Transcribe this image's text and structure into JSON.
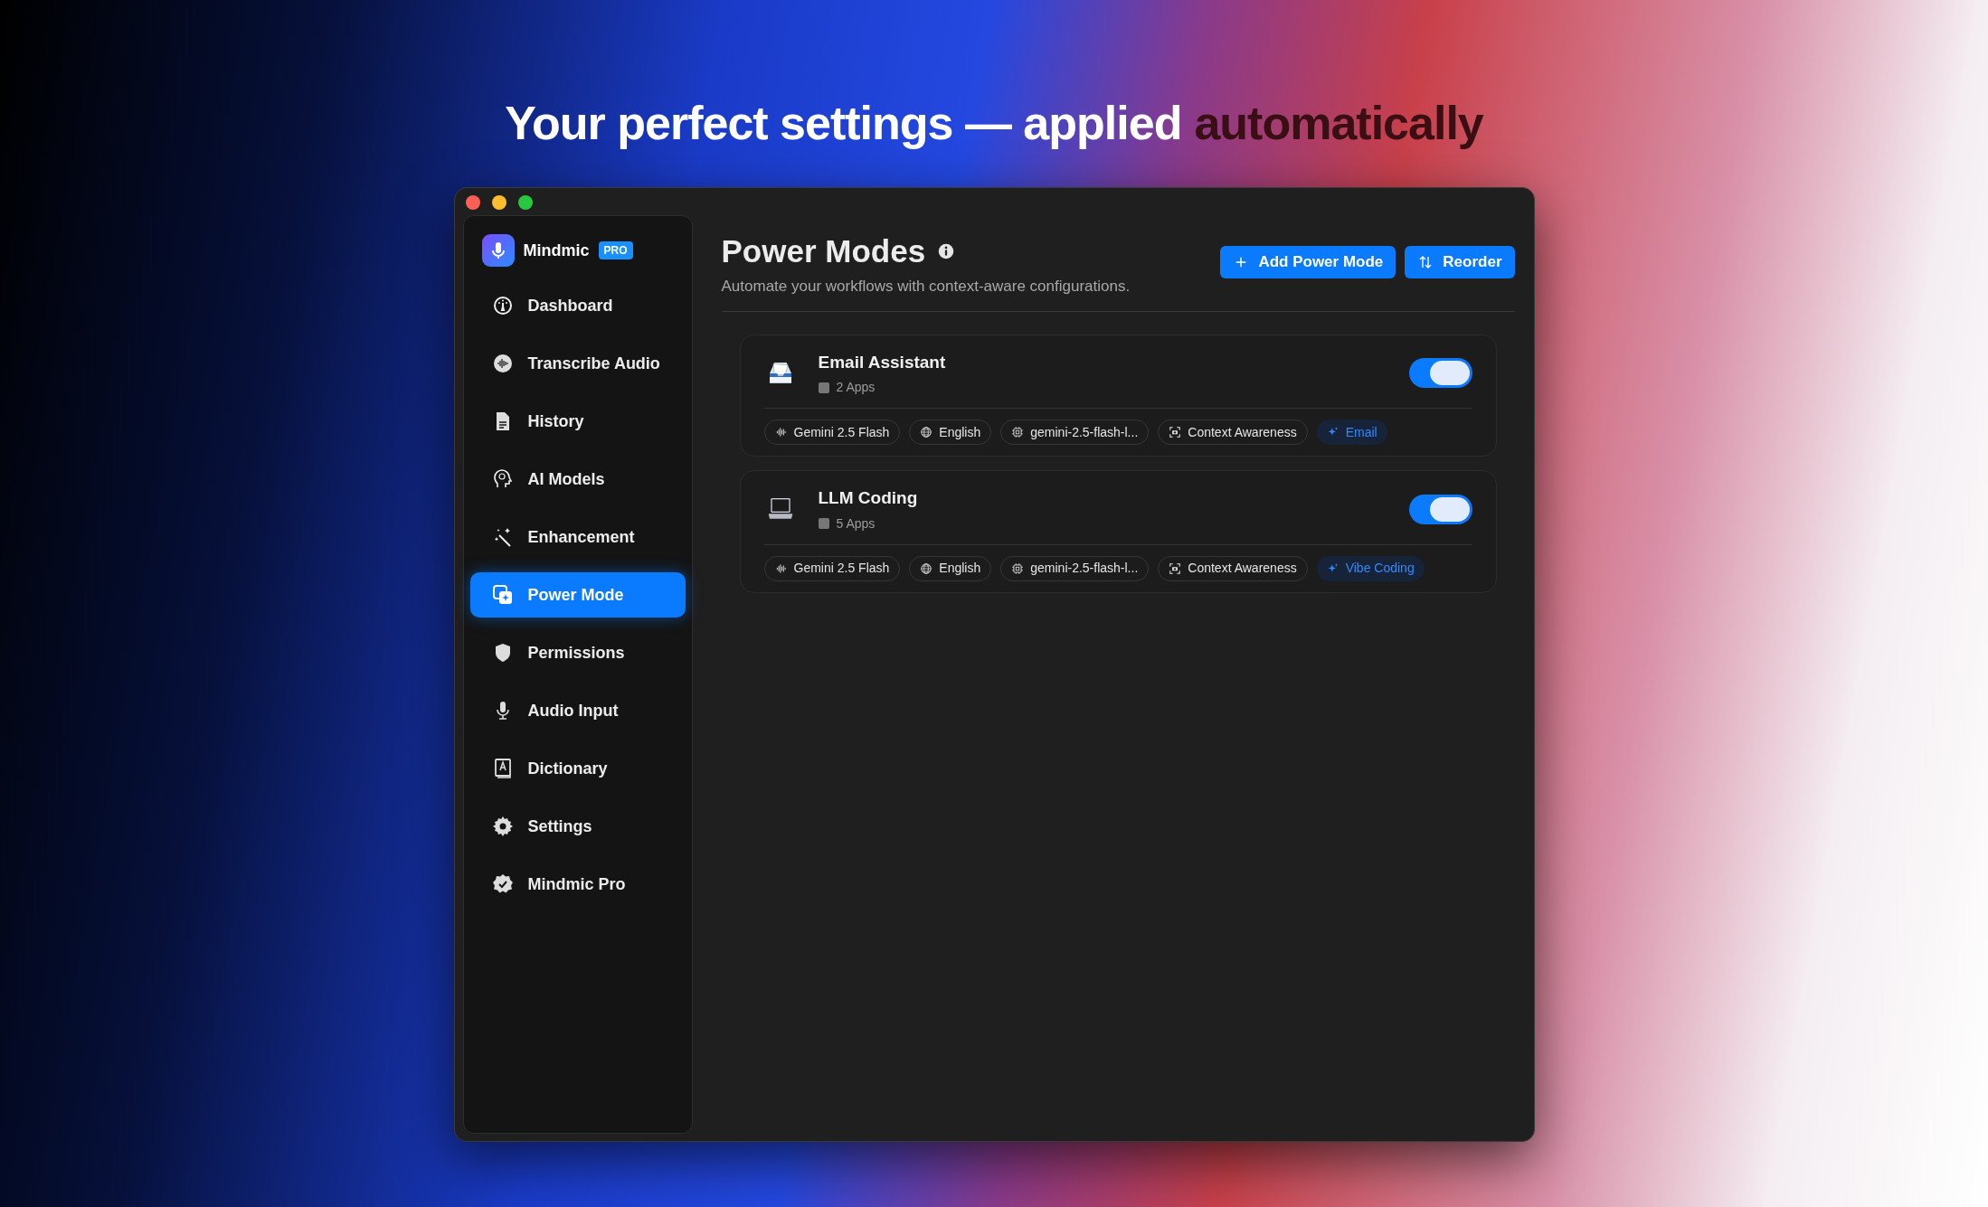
{
  "headline": {
    "text": "Your perfect settings — applied",
    "accent": "automatically"
  },
  "sidebar": {
    "app_name": "Mindmic",
    "badge": "PRO",
    "items": [
      {
        "label": "Dashboard",
        "selected": false
      },
      {
        "label": "Transcribe Audio",
        "selected": false
      },
      {
        "label": "History",
        "selected": false
      },
      {
        "label": "AI Models",
        "selected": false
      },
      {
        "label": "Enhancement",
        "selected": false
      },
      {
        "label": "Power Mode",
        "selected": true
      },
      {
        "label": "Permissions",
        "selected": false
      },
      {
        "label": "Audio Input",
        "selected": false
      },
      {
        "label": "Dictionary",
        "selected": false
      },
      {
        "label": "Settings",
        "selected": false
      },
      {
        "label": "Mindmic Pro",
        "selected": false
      }
    ]
  },
  "header": {
    "title": "Power Modes",
    "subtitle": "Automate your workflows with context-aware configurations.",
    "buttons": [
      "Add Power Mode",
      "Reorder"
    ]
  },
  "modes": [
    {
      "name": "Email Assistant",
      "apps": "2 Apps",
      "on": true,
      "chips": [
        {
          "kind": "voice",
          "label": "Gemini 2.5 Flash"
        },
        {
          "kind": "language",
          "label": "English"
        },
        {
          "kind": "model",
          "label": "gemini-2.5-flash-l..."
        },
        {
          "kind": "context",
          "label": "Context Awareness"
        },
        {
          "kind": "prompt",
          "label": "Email"
        }
      ]
    },
    {
      "name": "LLM Coding",
      "apps": "5 Apps",
      "on": true,
      "chips": [
        {
          "kind": "voice",
          "label": "Gemini 2.5 Flash"
        },
        {
          "kind": "language",
          "label": "English"
        },
        {
          "kind": "model",
          "label": "gemini-2.5-flash-l..."
        },
        {
          "kind": "context",
          "label": "Context Awareness"
        },
        {
          "kind": "prompt",
          "label": "Vibe Coding"
        }
      ]
    }
  ]
}
